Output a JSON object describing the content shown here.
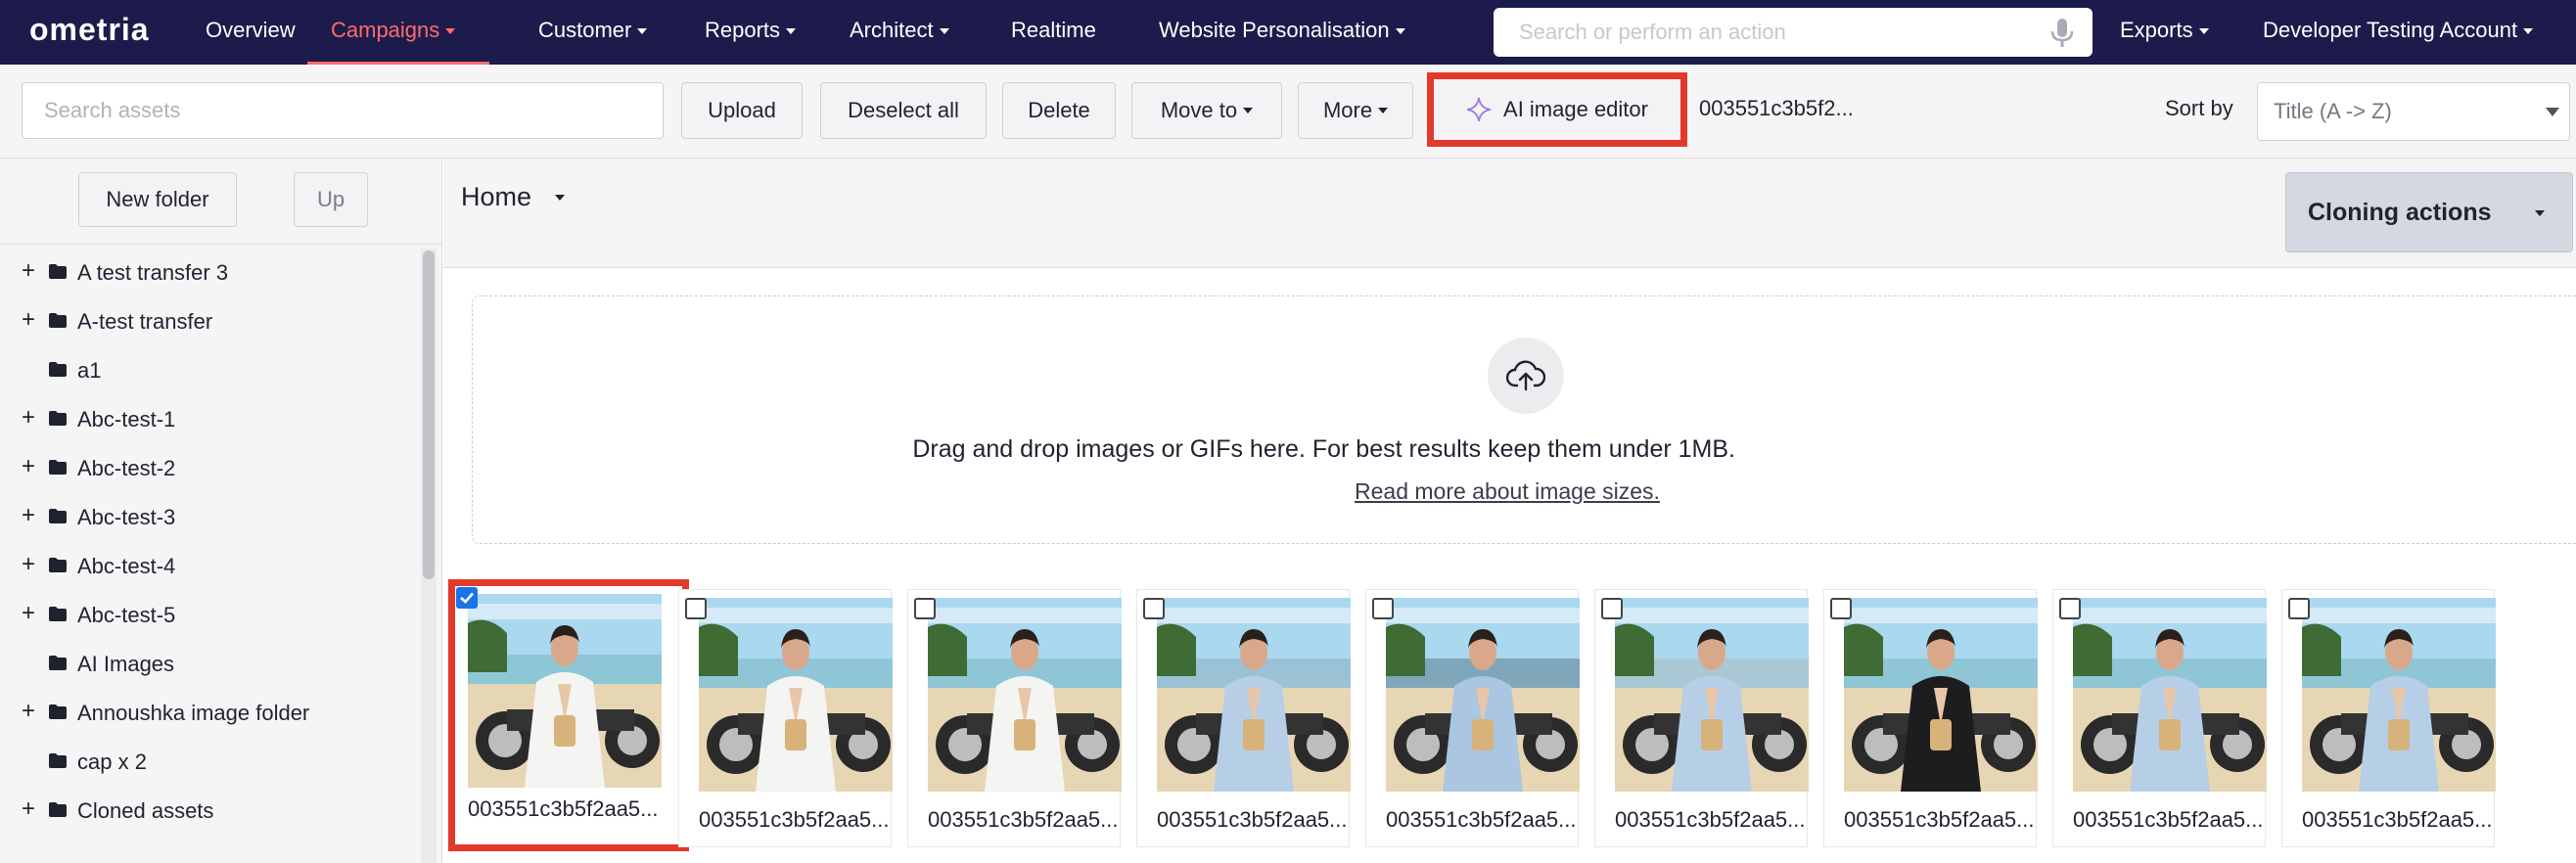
{
  "nav": {
    "logo": "ometria",
    "items": [
      {
        "label": "Overview",
        "dropdown": false
      },
      {
        "label": "Campaigns",
        "dropdown": true,
        "active": true
      },
      {
        "label": "Customer",
        "dropdown": true
      },
      {
        "label": "Reports",
        "dropdown": true
      },
      {
        "label": "Architect",
        "dropdown": true
      },
      {
        "label": "Realtime",
        "dropdown": false
      },
      {
        "label": "Website Personalisation",
        "dropdown": true
      }
    ],
    "search_placeholder": "Search or perform an action",
    "exports_label": "Exports",
    "account_label": "Developer Testing Account",
    "accent_color": "#ff6b6b",
    "bg_color": "#1d1b4b"
  },
  "toolbar": {
    "search_placeholder": "Search assets",
    "upload_label": "Upload",
    "deselect_label": "Deselect all",
    "delete_label": "Delete",
    "move_label": "Move to",
    "more_label": "More",
    "ai_editor_label": "AI image editor",
    "selected_file": "003551c3b5f2...",
    "sort_label": "Sort by",
    "sort_value": "Title (A -> Z)"
  },
  "sidebar": {
    "new_folder_label": "New folder",
    "up_label": "Up",
    "folders": [
      {
        "label": "A test transfer 3",
        "expandable": true
      },
      {
        "label": "A-test transfer",
        "expandable": true
      },
      {
        "label": "a1",
        "expandable": false
      },
      {
        "label": "Abc-test-1",
        "expandable": true
      },
      {
        "label": "Abc-test-2",
        "expandable": true
      },
      {
        "label": "Abc-test-3",
        "expandable": true
      },
      {
        "label": "Abc-test-4",
        "expandable": true
      },
      {
        "label": "Abc-test-5",
        "expandable": true
      },
      {
        "label": "AI Images",
        "expandable": false
      },
      {
        "label": "Annoushka image folder",
        "expandable": true
      },
      {
        "label": "cap x 2",
        "expandable": false
      },
      {
        "label": "Cloned assets",
        "expandable": true
      }
    ]
  },
  "main": {
    "breadcrumb": "Home",
    "cloning_label": "Cloning actions",
    "dropzone_text": "Drag and drop images or GIFs here. For best results keep them under 1MB.",
    "dropzone_link": "Read more about image sizes.",
    "assets": [
      {
        "name": "003551c3b5f2aa5...",
        "checked": true,
        "jacket": "#f4f4f2",
        "tone": "#8fc6d6"
      },
      {
        "name": "003551c3b5f2aa5...",
        "checked": false,
        "jacket": "#f4f4f2",
        "tone": "#8fc6d6"
      },
      {
        "name": "003551c3b5f2aa5...",
        "checked": false,
        "jacket": "#f4f4f2",
        "tone": "#8fc6d6"
      },
      {
        "name": "003551c3b5f2aa5...",
        "checked": false,
        "jacket": "#b6cfe6",
        "tone": "#9bc2d4"
      },
      {
        "name": "003551c3b5f2aa5...",
        "checked": false,
        "jacket": "#aac6e0",
        "tone": "#7fa7b9"
      },
      {
        "name": "003551c3b5f2aa5...",
        "checked": false,
        "jacket": "#b6cfe6",
        "tone": "#a9c8d6"
      },
      {
        "name": "003551c3b5f2aa5...",
        "checked": false,
        "jacket": "#1d1d1f",
        "tone": "#8fc6d6"
      },
      {
        "name": "003551c3b5f2aa5...",
        "checked": false,
        "jacket": "#b6cfe6",
        "tone": "#8fc6d6"
      },
      {
        "name": "003551c3b5f2aa5...",
        "checked": false,
        "jacket": "#b6cfe6",
        "tone": "#8fc6d6"
      }
    ]
  }
}
